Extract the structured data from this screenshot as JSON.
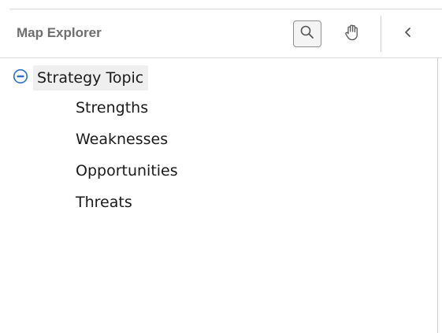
{
  "panel": {
    "title": "Map Explorer",
    "toolbar": {
      "search_icon": "magnifier-icon",
      "pan_icon": "hand-icon",
      "collapse_icon": "chevron-left-icon",
      "search_active": true
    }
  },
  "tree": {
    "root": {
      "label": "Strategy Topic",
      "expanded": true,
      "toggle_icon": "collapse-minus-circle-icon",
      "toggle_color": "#2f6fc7"
    },
    "children": [
      {
        "label": "Strengths"
      },
      {
        "label": "Weaknesses"
      },
      {
        "label": "Opportunities"
      },
      {
        "label": "Threats"
      }
    ]
  }
}
